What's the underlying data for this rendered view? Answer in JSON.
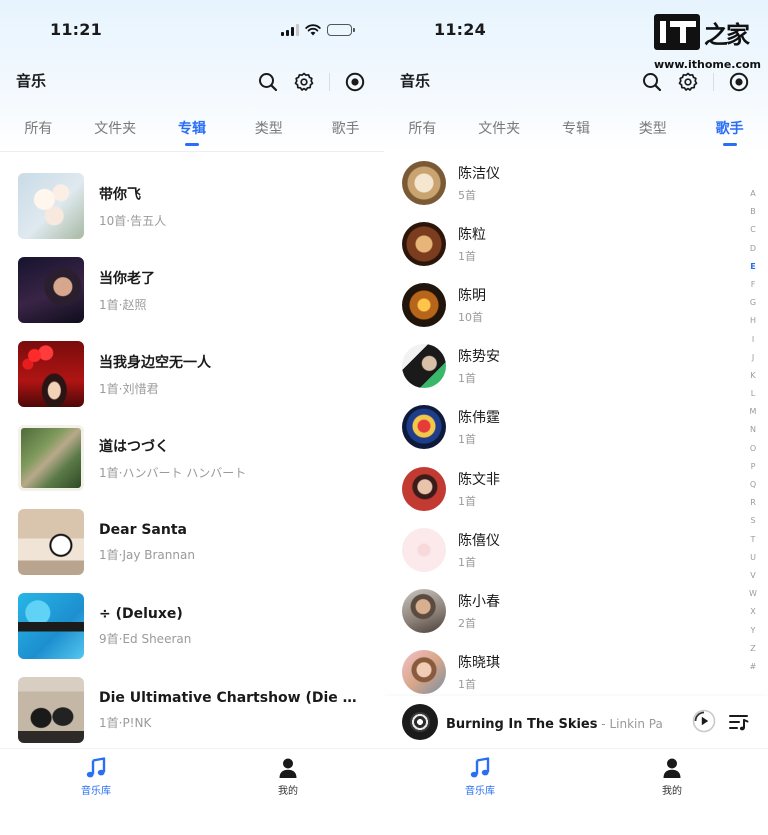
{
  "colors": {
    "accent": "#2a6ef5",
    "header_gradient_top": "#e7f4fd",
    "muted": "#9a9a9a"
  },
  "watermark": {
    "brand": "IT之家",
    "url": "www.ithome.com"
  },
  "left": {
    "status_time": "11:21",
    "app_title": "音乐",
    "tabs": [
      {
        "label": "所有",
        "active": false
      },
      {
        "label": "文件夹",
        "active": false
      },
      {
        "label": "专辑",
        "active": true
      },
      {
        "label": "类型",
        "active": false
      },
      {
        "label": "歌手",
        "active": false
      }
    ],
    "albums": [
      {
        "title": "带你飞",
        "subtitle": "10首·告五人"
      },
      {
        "title": "当你老了",
        "subtitle": "1首·赵照"
      },
      {
        "title": "当我身边空无一人",
        "subtitle": "1首·刘惜君"
      },
      {
        "title": "道はつづく",
        "subtitle": "1首·ハンバート ハンバート"
      },
      {
        "title": "Dear Santa",
        "subtitle": "1首·Jay Brannan"
      },
      {
        "title": "÷ (Deluxe)",
        "subtitle": "9首·Ed Sheeran"
      },
      {
        "title": "Die Ultimative Chartshow (Die Erf...",
        "subtitle": "1首·P!NK"
      }
    ],
    "nav": [
      {
        "label": "音乐库",
        "icon": "music-note-icon",
        "active": true
      },
      {
        "label": "我的",
        "icon": "person-icon",
        "active": false
      }
    ]
  },
  "right": {
    "status_time": "11:24",
    "app_title": "音乐",
    "tabs": [
      {
        "label": "所有",
        "active": false
      },
      {
        "label": "文件夹",
        "active": false
      },
      {
        "label": "专辑",
        "active": false
      },
      {
        "label": "类型",
        "active": false
      },
      {
        "label": "歌手",
        "active": true
      }
    ],
    "artists": [
      {
        "name": "陈洁仪",
        "count": "5首"
      },
      {
        "name": "陈粒",
        "count": "1首"
      },
      {
        "name": "陈明",
        "count": "10首"
      },
      {
        "name": "陈势安",
        "count": "1首"
      },
      {
        "name": "陈伟霆",
        "count": "1首"
      },
      {
        "name": "陈文非",
        "count": "1首"
      },
      {
        "name": "陈僖仪",
        "count": "1首"
      },
      {
        "name": "陈小春",
        "count": "2首"
      },
      {
        "name": "陈晓琪",
        "count": "1首"
      }
    ],
    "alpha_index": [
      "A",
      "B",
      "C",
      "D",
      "E",
      "F",
      "G",
      "H",
      "I",
      "J",
      "K",
      "L",
      "M",
      "N",
      "O",
      "P",
      "Q",
      "R",
      "S",
      "T",
      "U",
      "V",
      "W",
      "X",
      "Y",
      "Z",
      "#"
    ],
    "alpha_active": "E",
    "now_playing": {
      "song": "Burning In The Skies",
      "artist": "Linkin Park",
      "separator": " - "
    },
    "nav": [
      {
        "label": "音乐库",
        "icon": "music-note-icon",
        "active": true
      },
      {
        "label": "我的",
        "icon": "person-icon",
        "active": false
      }
    ]
  }
}
